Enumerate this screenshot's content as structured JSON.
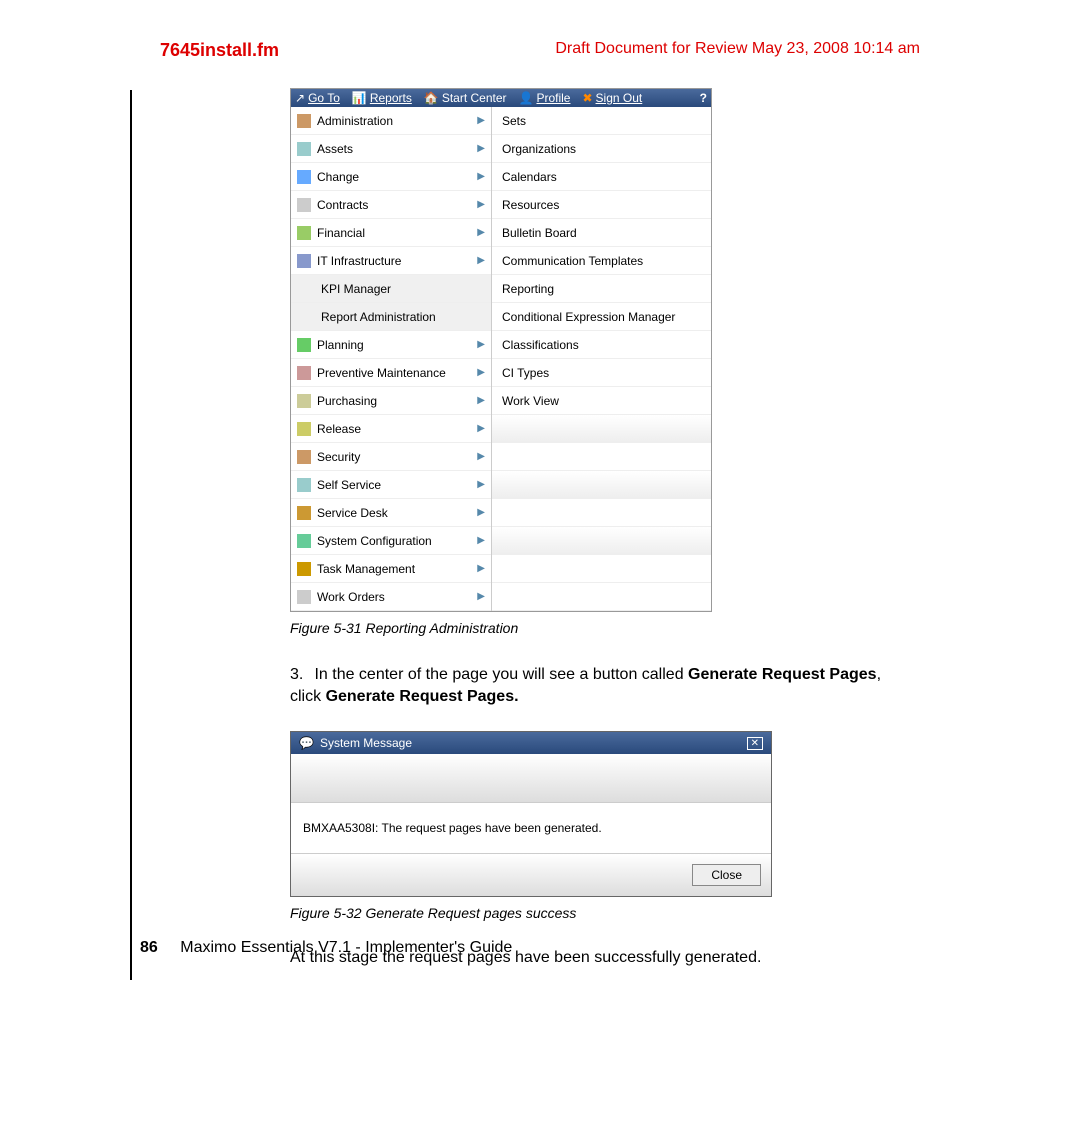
{
  "header": {
    "filename": "7645install.fm",
    "draft": "Draft Document for Review May 23, 2008 10:14 am"
  },
  "menubar": {
    "goto": "Go To",
    "reports": "Reports",
    "start_center": "Start Center",
    "profile": "Profile",
    "signout": "Sign Out"
  },
  "left_menu": {
    "items": [
      "Administration",
      "Assets",
      "Change",
      "Contracts",
      "Financial",
      "IT Infrastructure"
    ],
    "sub": [
      "KPI Manager",
      "Report Administration"
    ],
    "items2": [
      "Planning",
      "Preventive Maintenance",
      "Purchasing",
      "Release",
      "Security",
      "Self Service",
      "Service Desk",
      "System Configuration",
      "Task Management",
      "Work Orders"
    ]
  },
  "right_menu": {
    "items": [
      "Sets",
      "Organizations",
      "Calendars",
      "Resources",
      "Bulletin Board",
      "Communication Templates",
      "Reporting",
      "Conditional Expression Manager",
      "Classifications",
      "CI Types",
      "Work View"
    ]
  },
  "fig31": "Figure 5-31   Reporting Administration",
  "step3": {
    "num": "3.",
    "t1": "In the center of the page you will see a button called ",
    "b1": "Generate Request Pages",
    "t2": ", click ",
    "b2": "Generate Request Pages."
  },
  "dialog": {
    "title": "System Message",
    "msg": "BMXAA5308I: The request pages have been generated.",
    "close": "Close"
  },
  "fig32": "Figure 5-32   Generate Request pages success",
  "body1": "At this stage the request pages have been successfully generated.",
  "footer": {
    "page": "86",
    "title": "Maximo Essentials V7.1 - Implementer's Guide"
  }
}
